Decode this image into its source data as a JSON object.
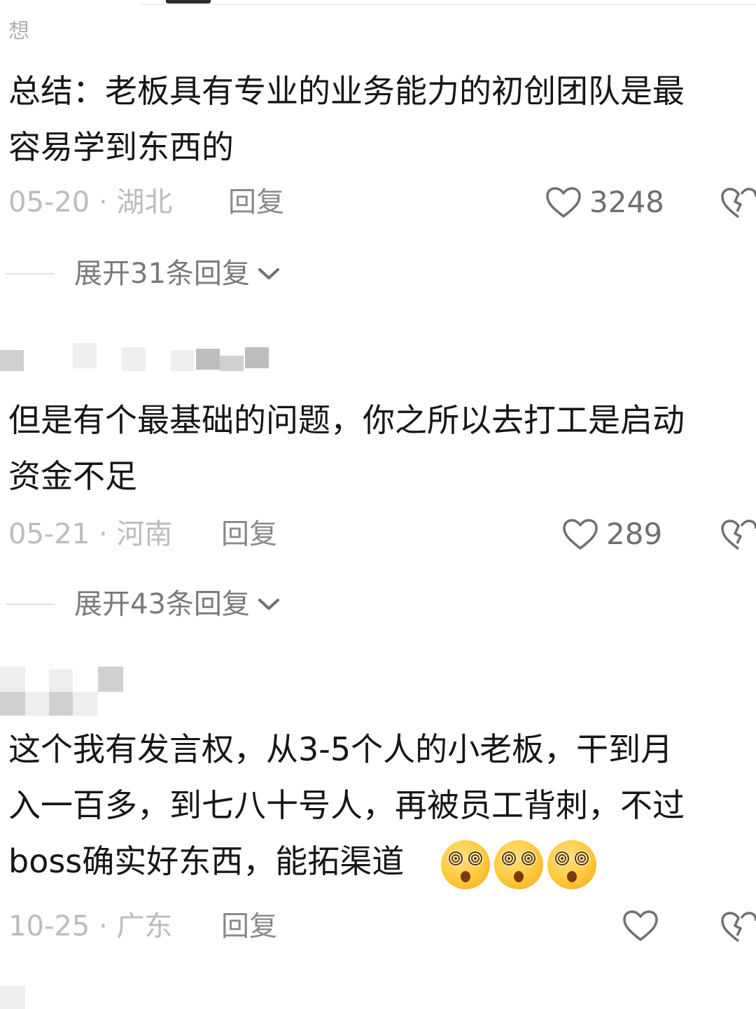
{
  "top_cut_text": "想",
  "comments": [
    {
      "text_lines": [
        "总结：老板具有专业的业务能力的初创团队是最",
        "容易学到东西的"
      ],
      "date": "05-20",
      "location": "湖北",
      "reply_label": "回复",
      "likes": "3248",
      "expand_label": "展开31条回复"
    },
    {
      "text_lines": [
        "但是有个最基础的问题，你之所以去打工是启动",
        "资金不足"
      ],
      "date": "05-21",
      "location": "河南",
      "reply_label": "回复",
      "likes": "289",
      "expand_label": "展开43条回复"
    },
    {
      "text_lines": [
        "这个我有发言权，从3-5个人的小老板，干到月",
        "入一百多，到七八十号人，再被员工背刺，不过",
        "boss确实好东西，能拓渠道"
      ],
      "emoji": [
        "dizzy-face",
        "dizzy-face",
        "dizzy-face"
      ],
      "date": "10-25",
      "location": "广东",
      "reply_label": "回复",
      "likes": ""
    }
  ],
  "meta_separator": " · ",
  "colors": {
    "text": "#161616",
    "meta": "#bcbcbc",
    "reply": "#8a8a8a",
    "icon": "#707070"
  },
  "icons": {
    "like": "heart-outline-icon",
    "dislike": "broken-heart-icon",
    "expand": "chevron-down-icon"
  }
}
